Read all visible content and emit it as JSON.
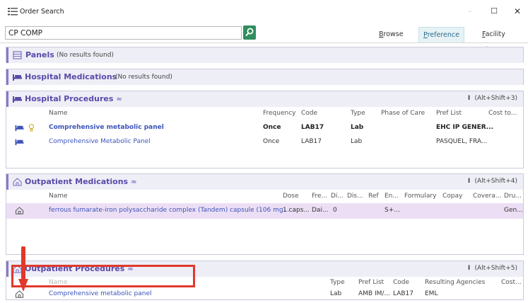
{
  "window": {
    "title": "Order Search",
    "minimize": "–",
    "maximize": "☐",
    "close": "✕"
  },
  "search": {
    "value": "CP COMP"
  },
  "tabs": [
    {
      "label": "Browse",
      "underline": "B",
      "rest": "rowse"
    },
    {
      "label": "Preference List",
      "underline": "P",
      "rest": "reference List",
      "active": true
    },
    {
      "label": "Facility List",
      "underline": "F",
      "rest": "acility List"
    }
  ],
  "panels": {
    "title": "Panels",
    "no_results": "(No results found)"
  },
  "hospital_medications": {
    "title": "Hospital Medications",
    "no_results": "(No results found)"
  },
  "hospital_procedures": {
    "title": "Hospital Procedures",
    "collapse": "≈",
    "hotkey": "(Alt+Shift+3)",
    "columns": [
      "Name",
      "Frequency",
      "Code",
      "Type",
      "Phase of Care",
      "Pref List",
      "Cost to..."
    ],
    "rows": [
      {
        "name": "Comprehensive metabolic panel",
        "frequency": "Once",
        "code": "LAB17",
        "type": "Lab",
        "pref_list": "EHC IP GENER...",
        "bold": true,
        "has_bulb": true
      },
      {
        "name": "Comprehensive Metabolic Panel",
        "frequency": "Once",
        "code": "LAB17",
        "type": "Lab",
        "pref_list": "PASQUEL, FRA...",
        "bold": false,
        "has_bulb": false
      }
    ]
  },
  "outpatient_medications": {
    "title": "Outpatient Medications",
    "collapse": "≈",
    "hotkey": "(Alt+Shift+4)",
    "columns": [
      "Name",
      "Dose",
      "Fre...",
      "Di...",
      "Dis...",
      "Ref",
      "En...",
      "Formulary",
      "Copay",
      "Covera...",
      "Dru..."
    ],
    "rows": [
      {
        "name": "ferrous fumarate-iron polysaccharide complex (Tandem) capsule (106 mg...",
        "dose": "1 caps...",
        "freq": "Dai...",
        "di": "0",
        "en": "S+...",
        "dru": "Gen..."
      }
    ]
  },
  "outpatient_procedures": {
    "title": "Outpatient Procedures",
    "collapse": "≈",
    "hotkey": "(Alt+Shift+5)",
    "columns": [
      "Name",
      "Type",
      "Pref List",
      "Code",
      "Resulting Agencies",
      "Cost..."
    ],
    "rows": [
      {
        "name": "Comprehensive metabolic panel",
        "type": "Lab",
        "pref_list": "AMB IM/...",
        "code": "LAB17",
        "resulting": "EML"
      }
    ]
  },
  "colors": {
    "accent": "#5a4aa8",
    "link": "#3d54b8",
    "search_button": "#2f8e5d",
    "annotation": "#e0392b",
    "selected_row": "#ecdff5"
  }
}
